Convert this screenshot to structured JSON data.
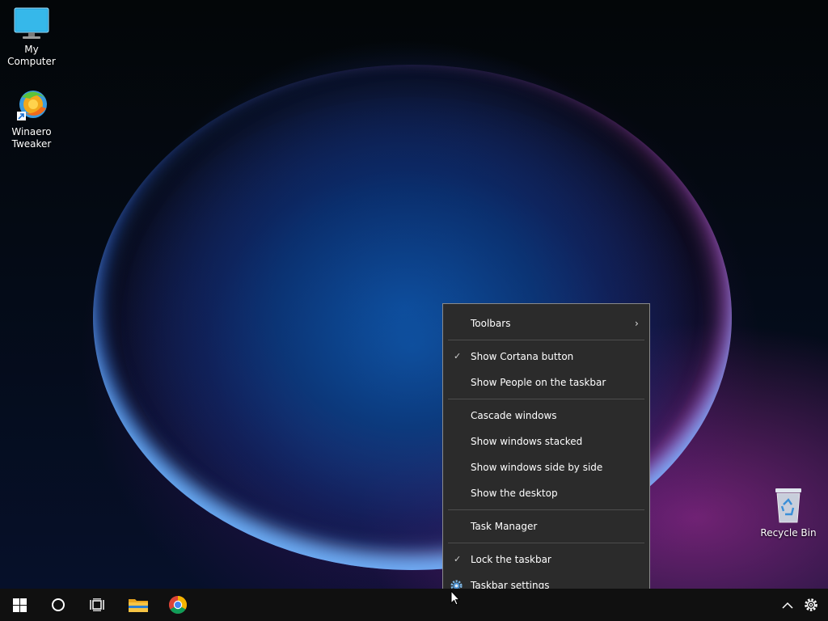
{
  "desktop": {
    "icons": [
      {
        "label": "My Computer",
        "icon": "monitor-icon"
      },
      {
        "label": "Winaero Tweaker",
        "icon": "winaero-tweaker-icon"
      },
      {
        "label": "Recycle Bin",
        "icon": "recycle-bin-icon"
      }
    ]
  },
  "context_menu": {
    "items": [
      {
        "label": "Toolbars",
        "has_submenu": true
      },
      {
        "label": "Show Cortana button",
        "checked": true
      },
      {
        "label": "Show People on the taskbar"
      },
      {
        "label": "Cascade windows"
      },
      {
        "label": "Show windows stacked"
      },
      {
        "label": "Show windows side by side"
      },
      {
        "label": "Show the desktop"
      },
      {
        "label": "Task Manager"
      },
      {
        "label": "Lock the taskbar",
        "checked": true
      },
      {
        "label": "Taskbar settings",
        "icon": "gear-icon"
      }
    ],
    "check_glyph": "✓",
    "submenu_glyph": "›"
  },
  "taskbar": {
    "buttons": [
      "windows-start-icon",
      "cortana-icon",
      "task-view-icon",
      "file-explorer-icon",
      "chrome-icon"
    ],
    "tray": [
      "chevron-up-icon",
      "gear-icon"
    ]
  },
  "colors": {
    "menu_bg": "#2b2b2b",
    "taskbar_bg": "#101010",
    "accent_blue": "#0078d7"
  }
}
